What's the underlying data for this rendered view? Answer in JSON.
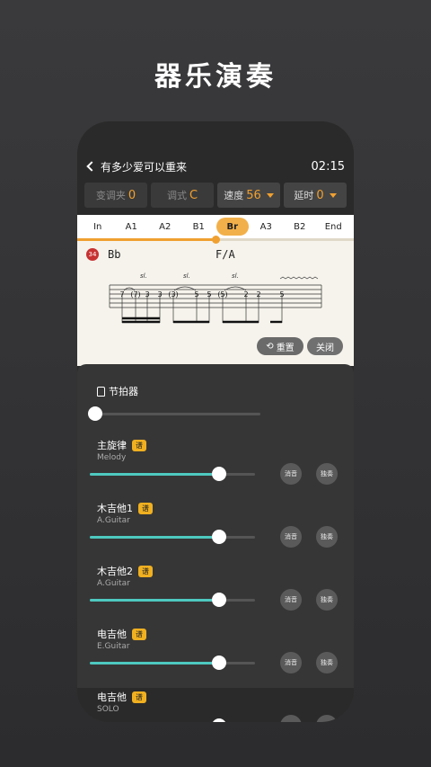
{
  "hero": {
    "title": "器乐演奏"
  },
  "header": {
    "back_label": "有多少爱可以重来",
    "time": "02:15"
  },
  "controls": [
    {
      "label": "变调夹",
      "value": "0"
    },
    {
      "label": "调式",
      "value": "C"
    },
    {
      "label": "速度",
      "value": "56"
    },
    {
      "label": "延时",
      "value": "0"
    }
  ],
  "sections": [
    "In",
    "A1",
    "A2",
    "B1",
    "Br",
    "A3",
    "B2",
    "End"
  ],
  "active_section": "Br",
  "playback_progress": 0.5,
  "sheet": {
    "bar_number": "34",
    "chords": [
      "Bb",
      "F/A"
    ],
    "slide_marks": [
      "sl.",
      "sl.",
      "sl."
    ],
    "tab_notes": [
      "7",
      "(7)",
      "3",
      "3",
      "(3)",
      "5",
      "5",
      "(5)",
      "2",
      "2",
      "5"
    ],
    "reset_label": "重置",
    "close_label": "关闭"
  },
  "mixer": {
    "metronome_label": "节拍器",
    "metronome_level": 0,
    "tracks": [
      {
        "name": "主旋律",
        "badge": "谱",
        "sub": "Melody",
        "level": 0.78,
        "mute": "消音",
        "solo": "独奏"
      },
      {
        "name": "木吉他1",
        "badge": "谱",
        "sub": "A.Guitar",
        "level": 0.78,
        "mute": "消音",
        "solo": "独奏"
      },
      {
        "name": "木吉他2",
        "badge": "谱",
        "sub": "A.Guitar",
        "level": 0.78,
        "mute": "消音",
        "solo": "独奏"
      },
      {
        "name": "电吉他",
        "badge": "谱",
        "sub": "E.Guitar",
        "level": 0.78,
        "mute": "消音",
        "solo": "独奏"
      },
      {
        "name": "电吉他",
        "badge": "谱",
        "sub": "SOLO",
        "level": 0.78,
        "mute": "消音",
        "solo": "独奏"
      }
    ]
  },
  "colors": {
    "accent": "#f0a030",
    "slider": "#4ec9c0",
    "badge": "#f0b020"
  }
}
